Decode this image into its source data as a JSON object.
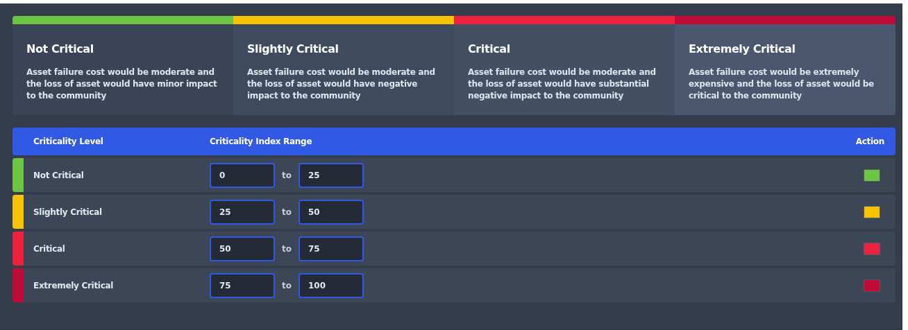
{
  "levels": [
    {
      "title": "Not Critical",
      "description": "Asset failure cost would be moderate and the loss of asset would have minor impact to the community",
      "color": "#6cc644"
    },
    {
      "title": "Slightly Critical",
      "description": "Asset failure cost would be moderate and the loss of asset would have negative impact to the community",
      "color": "#f8c300"
    },
    {
      "title": "Critical",
      "description": "Asset failure cost would be moderate and the loss of asset would have substantial negative impact to the community",
      "color": "#f0203f"
    },
    {
      "title": "Extremely Critical",
      "description": "Asset failure cost would be extremely expensive and the loss of asset would be critical to the community",
      "color": "#c00b38"
    }
  ],
  "table": {
    "columns": [
      "Criticality Level",
      "Criticality Index Range",
      "Action"
    ],
    "rows": [
      {
        "level": "Not Critical",
        "from": "0",
        "separator": "to",
        "to": "25",
        "color": "#6cc644"
      },
      {
        "level": "Slightly Critical",
        "from": "25",
        "separator": "to",
        "to": "50",
        "color": "#f8c300"
      },
      {
        "level": "Critical",
        "from": "50",
        "separator": "to",
        "to": "75",
        "color": "#f0203f"
      },
      {
        "level": "Extremely Critical",
        "from": "75",
        "separator": "to",
        "to": "100",
        "color": "#c00b38"
      }
    ]
  }
}
